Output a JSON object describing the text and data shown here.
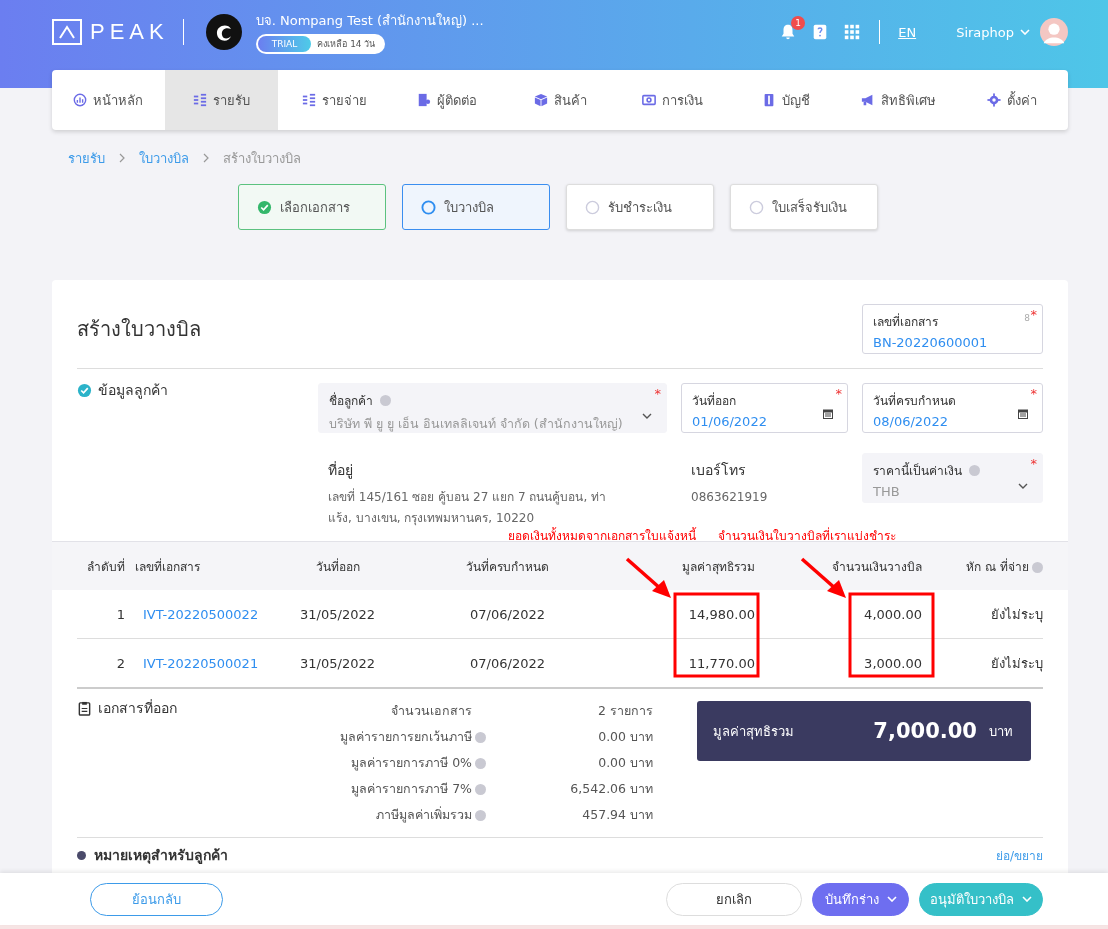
{
  "header": {
    "logo": "PEAK",
    "company": "บจ. Nompang Test (สำนักงานใหญ่) ...",
    "trial_badge": "TRIAL",
    "trial_remaining": "คงเหลือ 14 วัน",
    "notification_count": "1",
    "language": "EN",
    "user": "Siraphop"
  },
  "nav": [
    {
      "label": "หน้าหลัก",
      "selected": false
    },
    {
      "label": "รายรับ",
      "selected": true
    },
    {
      "label": "รายจ่าย",
      "selected": false
    },
    {
      "label": "ผู้ติดต่อ",
      "selected": false
    },
    {
      "label": "สินค้า",
      "selected": false
    },
    {
      "label": "การเงิน",
      "selected": false
    },
    {
      "label": "บัญชี",
      "selected": false
    },
    {
      "label": "สิทธิพิเศษ",
      "selected": false
    },
    {
      "label": "ตั้งค่า",
      "selected": false
    }
  ],
  "breadcrumb": [
    {
      "label": "รายรับ",
      "link": true
    },
    {
      "label": "ใบวางบิล",
      "link": true
    },
    {
      "label": "สร้างใบวางบิล",
      "link": false
    }
  ],
  "steps": [
    {
      "label": "เลือกเอกสาร",
      "checked": true,
      "selected": false
    },
    {
      "label": "ใบวางบิล",
      "checked": false,
      "selected": true
    },
    {
      "label": "รับชำระเงิน",
      "checked": false,
      "selected": false
    },
    {
      "label": "ใบเสร็จรับเงิน",
      "checked": false,
      "selected": false
    }
  ],
  "form": {
    "title": "สร้างใบวางบิล",
    "doc_number": {
      "label": "เลขที่เอกสาร",
      "counter": "8",
      "required_mark": "*",
      "value": "BN-20220600001"
    },
    "section_label": "ข้อมูลลูกค้า",
    "customer": {
      "label": "ชื่อลูกค้า",
      "required_mark": "*",
      "value": "บริษัท พี ยู ยู เอ็น อินเทลลิเจนท์ จำกัด (สำนักงานใหญ่)"
    },
    "issue_date": {
      "label": "วันที่ออก",
      "required_mark": "*",
      "value": "01/06/2022"
    },
    "due_date": {
      "label": "วันที่ครบกำหนด",
      "required_mark": "*",
      "value": "08/06/2022"
    },
    "address": {
      "label": "ที่อยู่",
      "value": "เลขที่ 145/161 ซอย คู้บอน 27 แยก 7 ถนนคู้บอน, ท่าแร้ง, บางเขน, กรุงเทพมหานคร, 10220"
    },
    "phone": {
      "label": "เบอร์โทร",
      "value": "0863621919"
    },
    "currency": {
      "label": "ราคานี้เป็นค่าเงิน",
      "required_mark": "*",
      "value": "THB"
    }
  },
  "annotations": [
    {
      "text": "ยอดเงินทั้งหมดจากเอกสารใบแจ้งหนี้"
    },
    {
      "text": "จำนวนเงินใบวางบิลที่เราแบ่งชำระ"
    }
  ],
  "table": {
    "columns": [
      {
        "label": "ลำดับที่",
        "highlighted": false,
        "help": false
      },
      {
        "label": "เลขที่เอกสาร",
        "highlighted": false,
        "help": false
      },
      {
        "label": "วันที่ออก",
        "highlighted": false,
        "help": false
      },
      {
        "label": "วันที่ครบกำหนด",
        "highlighted": false,
        "help": false
      },
      {
        "label": "มูลค่าสุทธิรวม",
        "highlighted": true,
        "help": false
      },
      {
        "label": "จำนวนเงินวางบิล",
        "highlighted": true,
        "help": false
      },
      {
        "label": "หัก ณ ที่จ่าย",
        "highlighted": false,
        "help": true
      }
    ],
    "rows": [
      [
        "1",
        "IVT-20220500022",
        "31/05/2022",
        "07/06/2022",
        "14,980.00",
        "4,000.00",
        "ยังไม่ระบุ"
      ],
      [
        "2",
        "IVT-20220500021",
        "31/05/2022",
        "07/06/2022",
        "11,770.00",
        "3,000.00",
        "ยังไม่ระบุ"
      ]
    ]
  },
  "summary": {
    "label": "เอกสารที่ออก",
    "rows": [
      {
        "label": "จำนวนเอกสาร",
        "help": false,
        "value": "2 รายการ"
      },
      {
        "label": "มูลค่ารายการยกเว้นภาษี",
        "help": true,
        "value": "0.00 บาท"
      },
      {
        "label": "มูลค่ารายการภาษี 0%",
        "help": true,
        "value": "0.00 บาท"
      },
      {
        "label": "มูลค่ารายการภาษี 7%",
        "help": true,
        "value": "6,542.06 บาท"
      },
      {
        "label": "ภาษีมูลค่าเพิ่มรวม",
        "help": true,
        "value": "457.94 บาท"
      }
    ],
    "total_label": "มูลค่าสุทธิรวม",
    "total": "7,000.00",
    "currency": "บาท"
  },
  "notes": {
    "label": "หมายเหตุสำหรับลูกค้า",
    "toggle": "ย่อ/ขยาย"
  },
  "footer": {
    "back": "ย้อนกลับ",
    "cancel": "ยกเลิก",
    "save_draft": "บันทึกร่าง",
    "approve": "อนุมัติใบวางบิล"
  }
}
